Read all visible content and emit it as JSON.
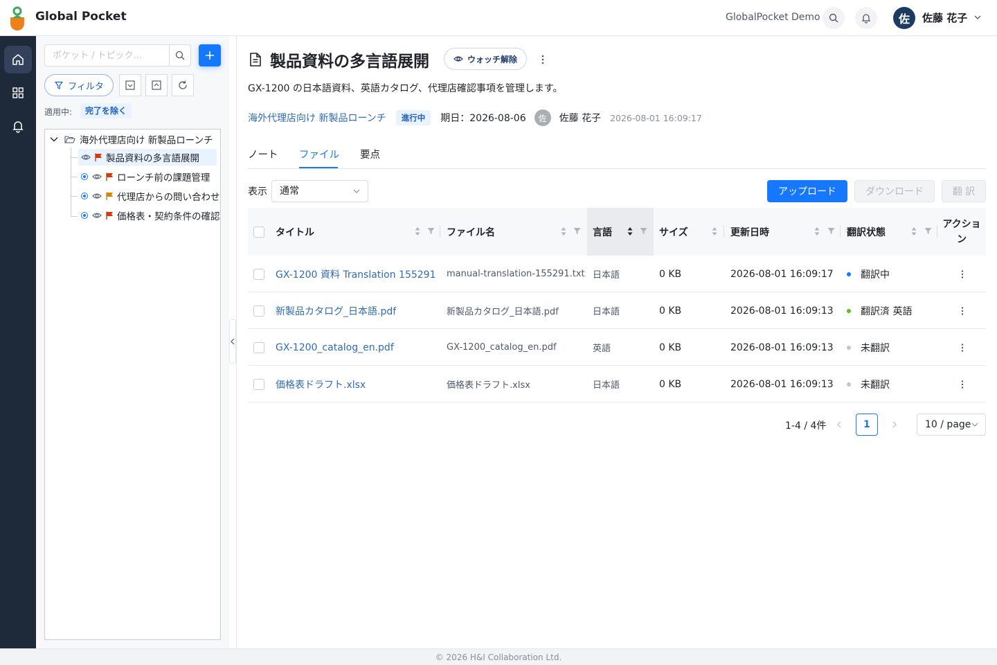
{
  "header": {
    "app_title": "Global Pocket",
    "org_name": "GlobalPocket Demo",
    "user_initial": "佐",
    "user_name": "佐藤 花子"
  },
  "rail": {
    "items": [
      "home-icon",
      "grid-icon",
      "bell-icon"
    ],
    "active": "home-icon"
  },
  "sidebar": {
    "search_placeholder": "ポケット / トピック...",
    "filter_label": "フィルタ",
    "applied_label": "適用中:",
    "applied_tag": "完了を除く",
    "tree": {
      "root": "海外代理店向け 新製品ローンチ",
      "children": [
        {
          "label": "製品資料の多言語展開",
          "flag_color": "#d4380d",
          "selected": true
        },
        {
          "label": "ローンチ前の課題管理",
          "flag_color": "#d4380d",
          "selected": false
        },
        {
          "label": "代理店からの問い合わせ",
          "flag_color": "#d48806",
          "selected": false
        },
        {
          "label": "価格表・契約条件の確認",
          "flag_color": "#d4380d",
          "selected": false
        }
      ]
    }
  },
  "topic": {
    "title": "製品資料の多言語展開",
    "watch_label": "ウォッチ解除",
    "description": "GX-1200 の日本語資料、英語カタログ、代理店確認事項を管理します。",
    "parent": "海外代理店向け 新製品ローンチ",
    "status": "進行中",
    "due": "期日：2026-08-06",
    "owner_initial": "佐",
    "owner": "佐藤 花子",
    "updated": "2026-08-01 16:09:17"
  },
  "tabs": [
    {
      "label": "ノート",
      "active": false
    },
    {
      "label": "ファイル",
      "active": true
    },
    {
      "label": "要点",
      "active": false
    }
  ],
  "toolbar": {
    "view_label": "表示",
    "view_value": "通常",
    "upload": "アップロード",
    "download": "ダウンロード",
    "translate": "翻 訳"
  },
  "table": {
    "columns": [
      "タイトル",
      "ファイル名",
      "言語",
      "サイズ",
      "更新日時",
      "翻訳状態",
      "アクション"
    ],
    "rows": [
      {
        "title": "GX-1200 資料 Translation 155291",
        "file": "manual-translation-155291.txt",
        "lang": "日本語",
        "size": "0 KB",
        "updated": "2026-08-01 16:09:17",
        "status": "翻訳中",
        "status_color": "#1677ff"
      },
      {
        "title": "新製品カタログ_日本語.pdf",
        "file": "新製品カタログ_日本語.pdf",
        "lang": "日本語",
        "size": "0 KB",
        "updated": "2026-08-01 16:09:13",
        "status": "翻訳済 英語",
        "status_color": "#52c41a"
      },
      {
        "title": "GX-1200_catalog_en.pdf",
        "file": "GX-1200_catalog_en.pdf",
        "lang": "英語",
        "size": "0 KB",
        "updated": "2026-08-01 16:09:13",
        "status": "未翻訳",
        "status_color": "#c0c4cc"
      },
      {
        "title": "価格表ドラフト.xlsx",
        "file": "価格表ドラフト.xlsx",
        "lang": "日本語",
        "size": "0 KB",
        "updated": "2026-08-01 16:09:13",
        "status": "未翻訳",
        "status_color": "#c0c4cc"
      }
    ]
  },
  "pagination": {
    "total": "1-4 / 4件",
    "current": "1",
    "page_size": "10 / page"
  },
  "footer": "© 2026 H&I Collaboration Ltd."
}
